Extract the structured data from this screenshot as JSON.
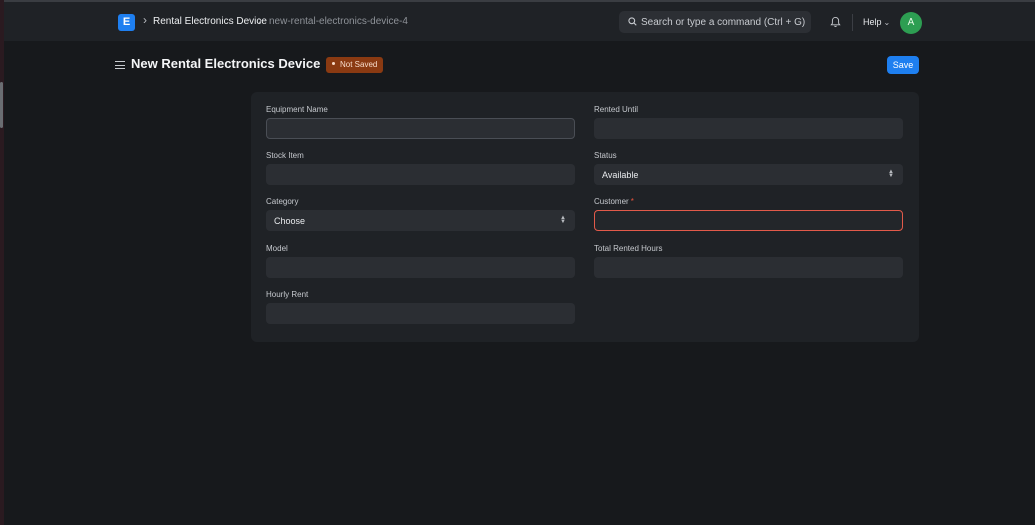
{
  "navbar": {
    "logo_letter": "E",
    "breadcrumbs": [
      "Rental Electronics Device",
      "new-rental-electronics-device-4"
    ],
    "search_placeholder": "Search or type a command (Ctrl + G)",
    "help_label": "Help",
    "avatar_initial": "A"
  },
  "page": {
    "title": "New Rental Electronics Device",
    "status_badge": "Not Saved",
    "save_label": "Save"
  },
  "form": {
    "equipment_name": {
      "label": "Equipment Name",
      "value": ""
    },
    "stock_item": {
      "label": "Stock Item",
      "value": ""
    },
    "category": {
      "label": "Category",
      "value": "Choose"
    },
    "model": {
      "label": "Model",
      "value": ""
    },
    "hourly_rent": {
      "label": "Hourly Rent",
      "value": ""
    },
    "rented_until": {
      "label": "Rented Until",
      "value": ""
    },
    "status": {
      "label": "Status",
      "value": "Available"
    },
    "customer": {
      "label": "Customer",
      "required_mark": "*",
      "value": ""
    },
    "total_rented_hours": {
      "label": "Total Rented Hours",
      "value": ""
    }
  },
  "colors": {
    "accent": "#1e7ff0",
    "not_saved_badge": "#8a3a12",
    "error_border": "#e25a4a",
    "avatar": "#2d9e52"
  }
}
